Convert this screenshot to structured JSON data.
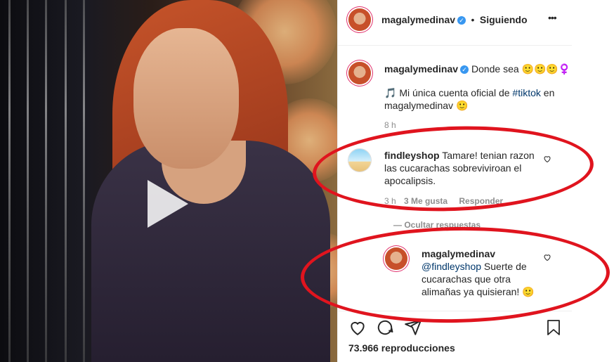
{
  "post": {
    "username": "magalymedinav",
    "verified_mark": "✓",
    "separator": "•",
    "follow_status": "Siguiendo",
    "more_icon": "•••"
  },
  "caption": {
    "username": "magalymedinav",
    "text": "Donde sea 🙂🙂🙂‍♀️",
    "line2_prefix": "🎵 Mi única cuenta oficial de ",
    "hashtag": "#tiktok",
    "line2_suffix": " en",
    "line3": "magalymedinav 🙂",
    "time": "8 h"
  },
  "comments": [
    {
      "username": "findleyshop",
      "text": "Tamare! tenian razon las cucarachas sobreviviroan el apocalipsis.",
      "time": "3 h",
      "likes": "3 Me gusta",
      "reply_label": "Responder",
      "hide_replies": "— Ocultar respuestas"
    }
  ],
  "reply": {
    "username": "magalymedinav",
    "mention": "@findleyshop",
    "text": " Suerte de cucarachas que otra alimañas ya quisieran! 🙂"
  },
  "actions": {
    "views": "73.966 reproducciones"
  },
  "colors": {
    "annotation_red": "#e0141e",
    "link_blue": "#00376b",
    "verified_blue": "#3897f0"
  }
}
